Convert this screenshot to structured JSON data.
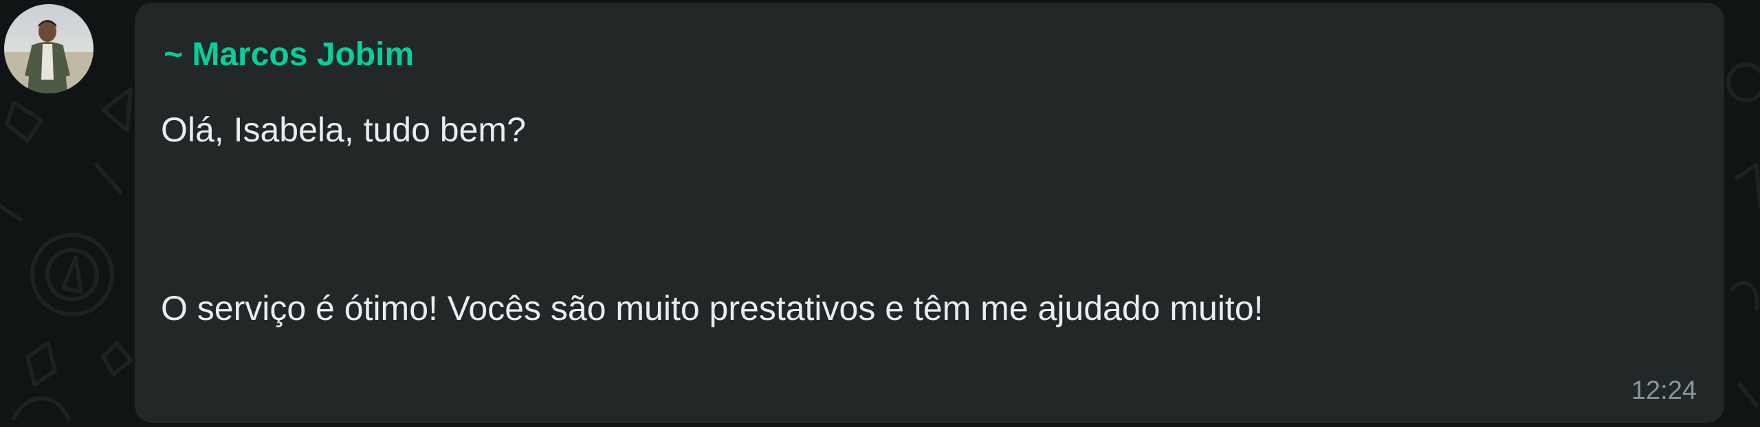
{
  "message": {
    "sender_name": "~ Marcos Jobim",
    "lines": [
      "Olá, Isabela, tudo bem?",
      "O serviço é ótimo! Vocês são muito prestativos e têm me ajudado muito!"
    ],
    "time": "12:24"
  },
  "icons": {
    "avatar": "sender-avatar-photo",
    "background": "chat-doodle-wallpaper"
  },
  "colors": {
    "background": "#111414",
    "bubble": "#222727",
    "sender_name": "#06cf9c",
    "message_text": "#e9edef",
    "timestamp": "#8696a0"
  }
}
